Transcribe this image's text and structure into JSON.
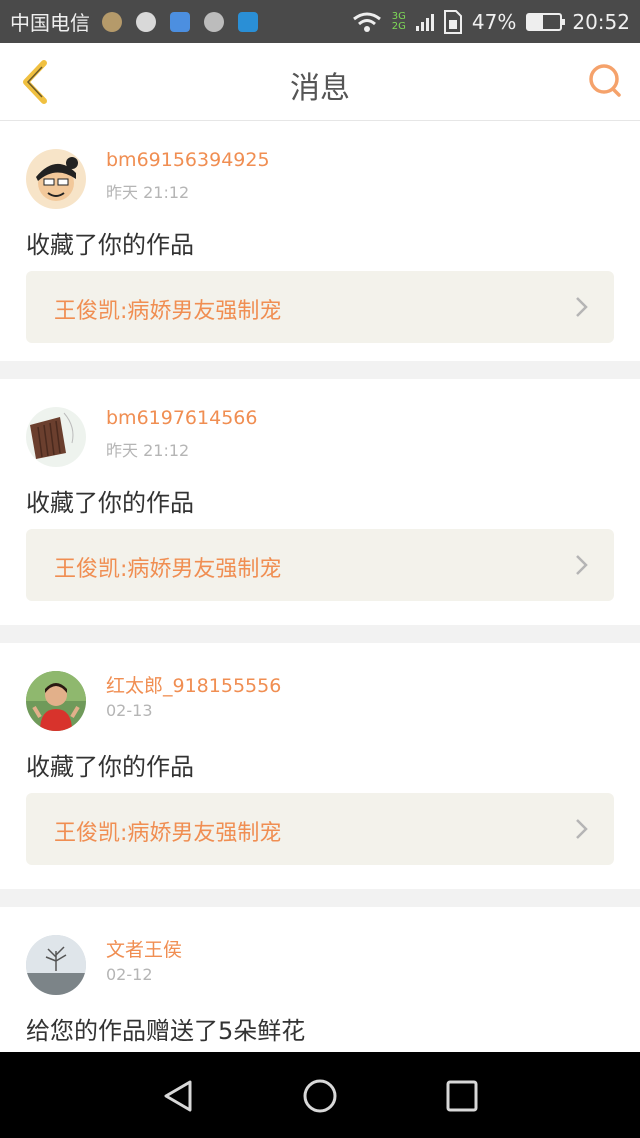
{
  "status_bar": {
    "carrier": "中国电信",
    "network_top": "3G",
    "network_bottom": "2G",
    "battery_percent": "47%",
    "battery_level": 0.47,
    "time": "20:52"
  },
  "header": {
    "title": "消息",
    "back_icon": "chevron-left-icon",
    "search_icon": "search-icon"
  },
  "colors": {
    "accent": "#f08e52",
    "back_icon": "#f0c040",
    "work_bg": "#f3f2eb"
  },
  "messages": [
    {
      "username": "bm69156394925",
      "time": "昨天 21:12",
      "action": "收藏了你的作品",
      "work_title": "王俊凯:病娇男友强制宠"
    },
    {
      "username": "bm6197614566",
      "time": "昨天 21:12",
      "action": "收藏了你的作品",
      "work_title": "王俊凯:病娇男友强制宠"
    },
    {
      "username": "红太郎_918155556",
      "time": "02-13",
      "action": "收藏了你的作品",
      "work_title": "王俊凯:病娇男友强制宠"
    },
    {
      "username": "文者王侯",
      "time": "02-12",
      "action": "给您的作品赠送了5朵鲜花"
    }
  ]
}
